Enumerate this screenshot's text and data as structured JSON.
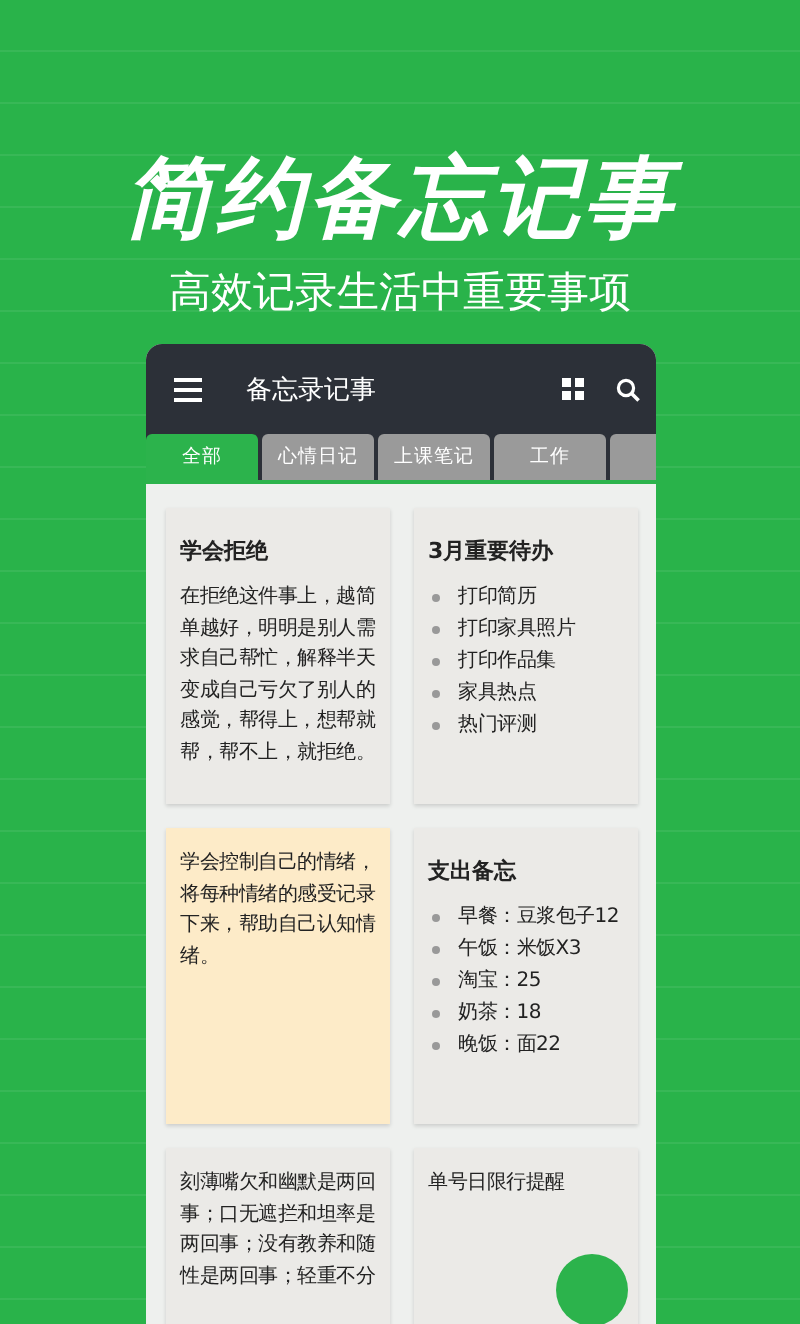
{
  "headline": "简约备忘记事",
  "subtitle": "高效记录生活中重要事项",
  "app_bar": {
    "title": "备忘录记事"
  },
  "tabs": [
    {
      "label": "全部",
      "selected": true
    },
    {
      "label": "心情日记",
      "selected": false
    },
    {
      "label": "上课笔记",
      "selected": false
    },
    {
      "label": "工作",
      "selected": false
    }
  ],
  "notes": [
    {
      "kind": "text",
      "title": "学会拒绝",
      "body": "在拒绝这件事上，越简单越好，明明是别人需求自己帮忙，解释半天变成自己亏欠了别人的感觉，帮得上，想帮就帮，帮不上，就拒绝。",
      "color": "#ebeae7"
    },
    {
      "kind": "list",
      "title": "3月重要待办",
      "items": [
        "打印简历",
        "打印家具照片",
        "打印作品集",
        "家具热点",
        "热门评测"
      ],
      "color": "#ebeae7"
    },
    {
      "kind": "text",
      "body": "学会控制自己的情绪，将每种情绪的感受记录下来，帮助自己认知情绪。",
      "color": "#fdebc8"
    },
    {
      "kind": "list",
      "title": "支出备忘",
      "items": [
        "早餐：豆浆包子12",
        "午饭：米饭X3",
        "淘宝：25",
        "奶茶：18",
        "晚饭：面22"
      ],
      "color": "#ebeae7"
    },
    {
      "kind": "text",
      "body": "刻薄嘴欠和幽默是两回事；口无遮拦和坦率是两回事；没有教养和随性是两回事；轻重不分",
      "color": "#ebeae7"
    },
    {
      "kind": "text",
      "body": "单号日限行提醒",
      "color": "#ebeae7"
    }
  ]
}
